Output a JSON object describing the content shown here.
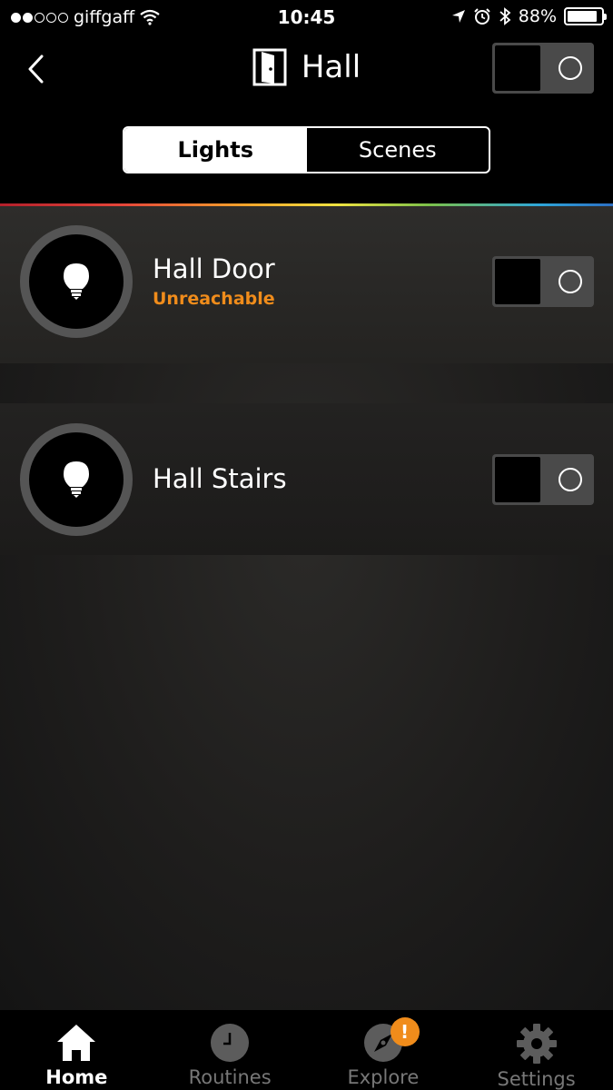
{
  "status_bar": {
    "carrier": "giffgaff",
    "time": "10:45",
    "battery": "88%",
    "battery_level": 0.88
  },
  "header": {
    "title": "Hall",
    "room_icon": "door-icon",
    "master_toggle_on": false
  },
  "segments": [
    {
      "label": "Lights",
      "active": true
    },
    {
      "label": "Scenes",
      "active": false
    }
  ],
  "lights": [
    {
      "name": "Hall Door",
      "status": "Unreachable",
      "on": false
    },
    {
      "name": "Hall Stairs",
      "status": "",
      "on": false
    }
  ],
  "tabbar": [
    {
      "label": "Home",
      "icon": "home-icon",
      "active": true
    },
    {
      "label": "Routines",
      "icon": "clock-icon",
      "active": false
    },
    {
      "label": "Explore",
      "icon": "compass-icon",
      "active": false,
      "badge": "!"
    },
    {
      "label": "Settings",
      "icon": "gear-icon",
      "active": false
    }
  ],
  "colors": {
    "accent": "#f08c1b",
    "background": "#1e1d1c",
    "toggle_track": "#4a4a4a"
  }
}
